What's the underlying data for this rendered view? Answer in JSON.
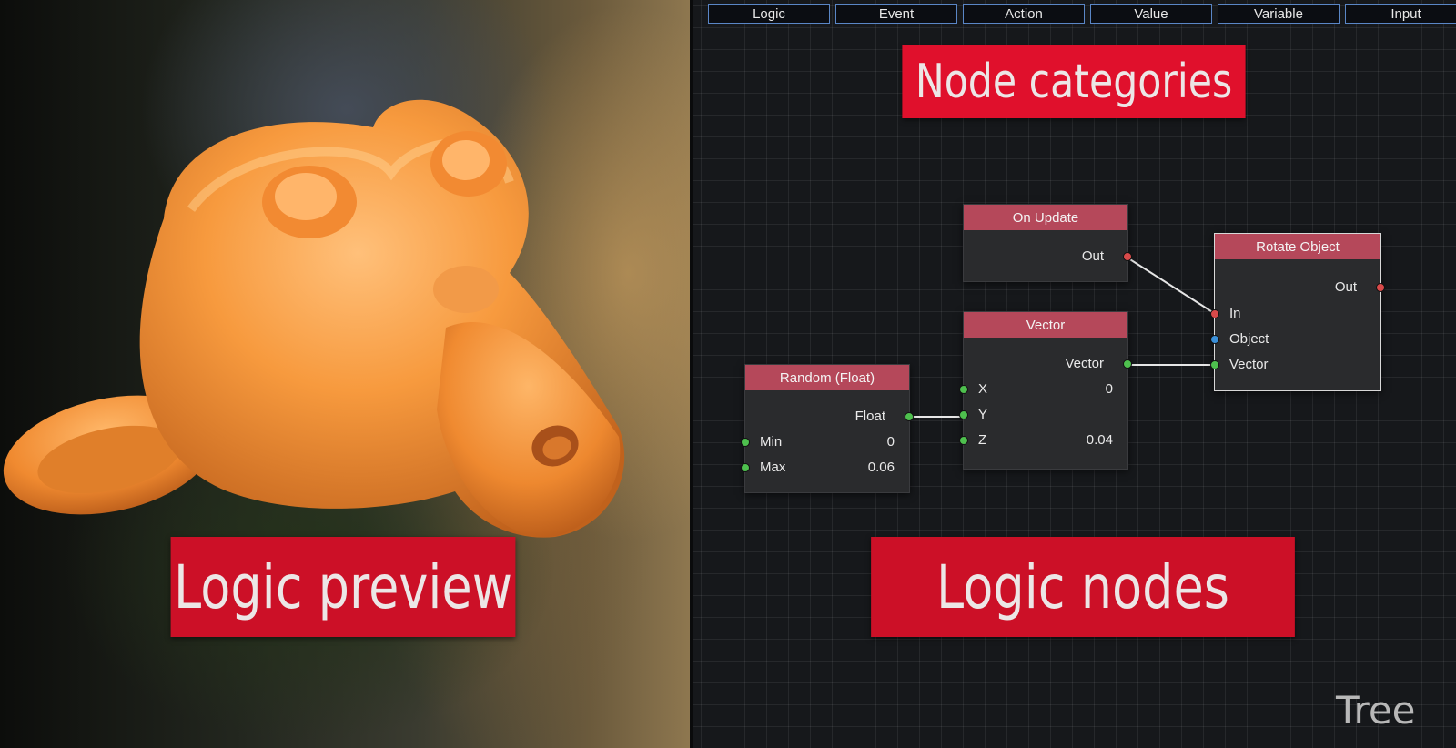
{
  "preview": {
    "label": "Logic preview"
  },
  "editor": {
    "categories_label": "Node categories",
    "nodes_label": "Logic nodes",
    "tree_label": "Tree",
    "tabs": [
      "Logic",
      "Event",
      "Action",
      "Value",
      "Variable",
      "Input"
    ]
  },
  "nodes": {
    "on_update": {
      "title": "On Update",
      "out": "Out"
    },
    "rotate_object": {
      "title": "Rotate Object",
      "out": "Out",
      "in": "In",
      "object": "Object",
      "vector": "Vector"
    },
    "vector": {
      "title": "Vector",
      "out": "Vector",
      "x": "X",
      "x_val": "0",
      "y": "Y",
      "z": "Z",
      "z_val": "0.04"
    },
    "random_float": {
      "title": "Random (Float)",
      "out": "Float",
      "min": "Min",
      "min_val": "0",
      "max": "Max",
      "max_val": "0.06"
    }
  },
  "colors": {
    "label_red": "#cc1027",
    "header": "#b5485a",
    "socket_green": "#4ec04e",
    "socket_red": "#d84a4a",
    "socket_blue": "#3a8fd8"
  }
}
